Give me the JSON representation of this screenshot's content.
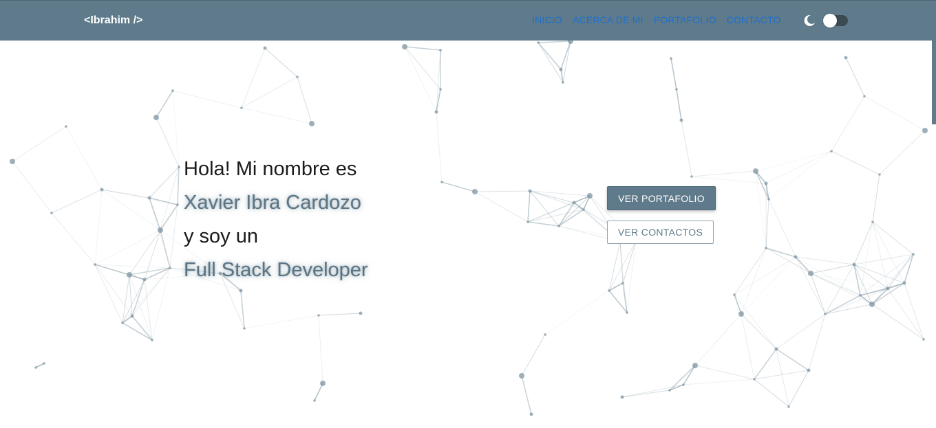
{
  "brand": "<Ibrahim />",
  "nav": {
    "links": [
      "INICIO",
      "ACERCA DE MI",
      "PORTAFOLIO",
      "CONTACTO"
    ],
    "theme_icon": "moon-icon",
    "dark_mode_enabled": false
  },
  "hero": {
    "line1": "Hola! Mi nombre es",
    "name": "Xavier Ibra Cardozo",
    "line3": "y soy un",
    "role": "Full Stack Developer"
  },
  "buttons": {
    "portfolio": "VER PORTAFOLIO",
    "contacts": "VER CONTACTOS"
  },
  "colors": {
    "navbar": "#5f7b8b",
    "accent": "#5a7585",
    "nav_link": "#1a6fd1",
    "network": "#8fa3ae"
  }
}
